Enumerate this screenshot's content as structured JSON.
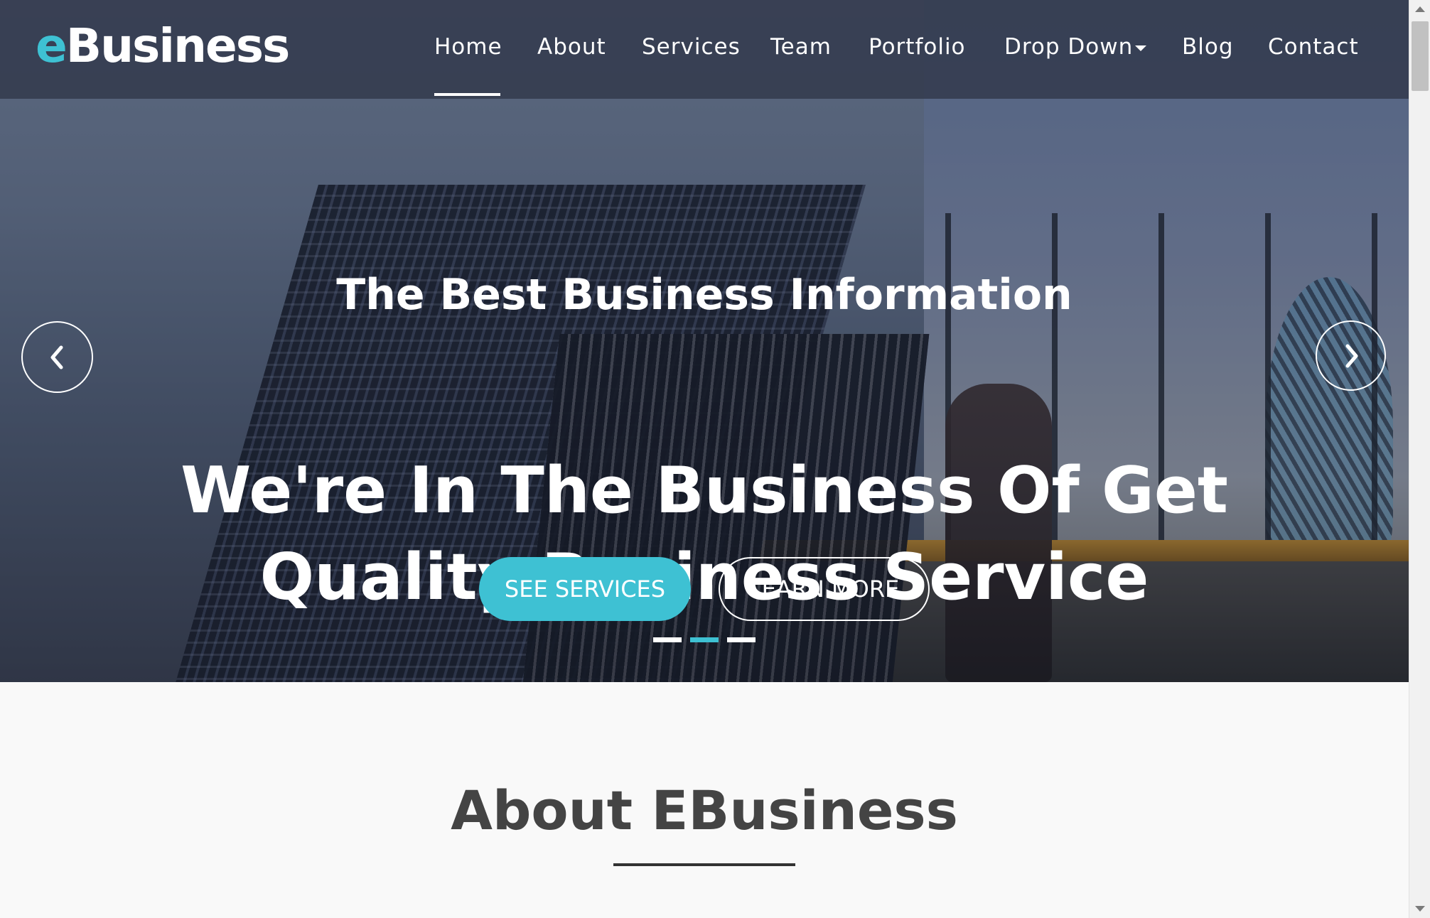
{
  "brand": {
    "accent_letter": "e",
    "rest": "Business",
    "accent_color": "#3ec1d3"
  },
  "nav": {
    "items": [
      {
        "label": "Home",
        "active": true
      },
      {
        "label": "About"
      },
      {
        "label": "Services"
      },
      {
        "label": "Team"
      },
      {
        "label": "Portfolio"
      },
      {
        "label": "Drop Down",
        "icon": "caret-down-icon"
      },
      {
        "label": "Blog"
      },
      {
        "label": "Contact"
      }
    ]
  },
  "hero": {
    "kicker": "The Best Business Information",
    "title": "We're In The Business Of Get Quality Business Service",
    "primary_button": "SEE SERVICES",
    "secondary_button": "LEARN MORE",
    "prev_icon": "chevron-left-icon",
    "next_icon": "chevron-right-icon",
    "active_slide": 2,
    "slide_count": 3
  },
  "about": {
    "title": "About EBusiness"
  }
}
